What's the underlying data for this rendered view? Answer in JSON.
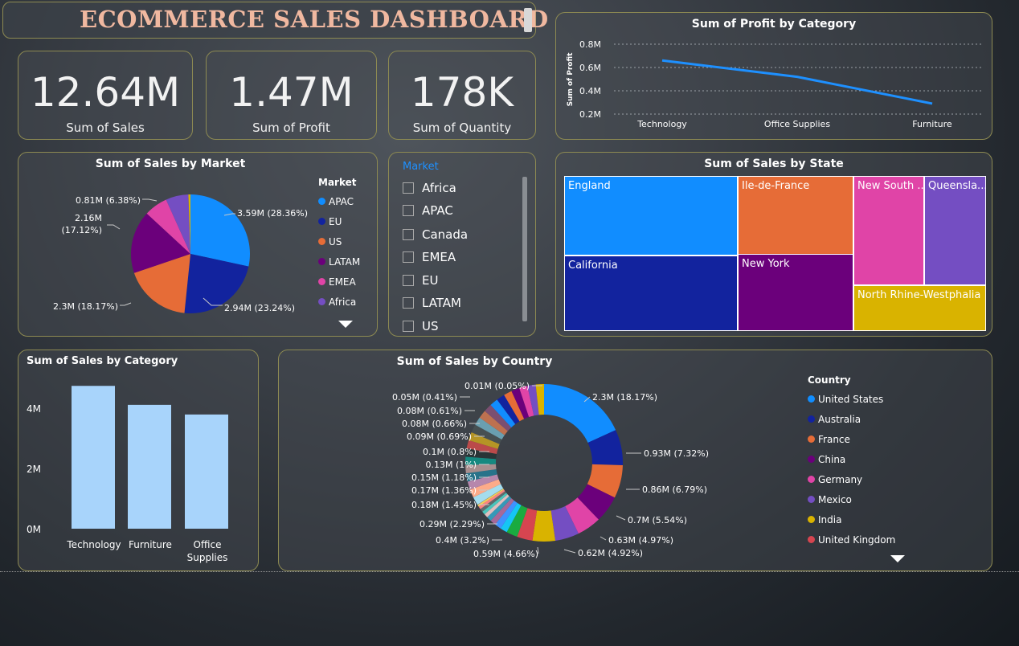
{
  "header": {
    "title": "ECOMMERCE SALES DASHBOARD"
  },
  "kpis": [
    {
      "value": "12.64M",
      "label": "Sum of Sales"
    },
    {
      "value": "1.47M",
      "label": "Sum of Profit"
    },
    {
      "value": "178K",
      "label": "Sum of Quantity"
    }
  ],
  "profit_chart": {
    "title": "Sum of Profit by Category",
    "ylabel": "Sum of Profit",
    "yticks": [
      "0.8M",
      "0.6M",
      "0.4M",
      "0.2M"
    ],
    "categories": [
      "Technology",
      "Office Supplies",
      "Furniture"
    ],
    "line_color": "#1e90ff"
  },
  "market_pie": {
    "title": "Sum of Sales by Market",
    "legend_title": "Market",
    "labels": [
      "3.59M (28.36%)",
      "2.94M (23.24%)",
      "2.3M (18.17%)",
      "2.16M",
      "(17.12%)",
      "0.81M (6.38%)"
    ]
  },
  "market_slicer": {
    "title": "Market",
    "items": [
      "Africa",
      "APAC",
      "Canada",
      "EMEA",
      "EU",
      "LATAM",
      "US"
    ]
  },
  "state_treemap": {
    "title": "Sum of Sales by State",
    "cells": [
      "England",
      "Ile-de-France",
      "New South ...",
      "Queensla...",
      "California",
      "New York",
      "North Rhine-Westphalia"
    ]
  },
  "category_bar": {
    "title": "Sum of Sales by Category",
    "yticks": [
      "4M",
      "2M",
      "0M"
    ],
    "categories": [
      "Technology",
      "Furniture",
      "Office",
      "Supplies"
    ],
    "bar_color": "#a8d4fb"
  },
  "country_donut": {
    "title": "Sum of Sales by Country",
    "legend_title": "Country",
    "right_labels": [
      "2.3M (18.17%)",
      "0.93M (7.32%)",
      "0.86M (6.79%)",
      "0.7M (5.54%)",
      "0.63M (4.97%)",
      "0.62M (4.92%)",
      "0.59M (4.66%)"
    ],
    "left_labels": [
      "0.01M (0.05%)",
      "0.05M (0.41%)",
      "0.08M (0.61%)",
      "0.08M (0.66%)",
      "0.09M (0.69%)",
      "0.1M (0.8%)",
      "0.13M (1%)",
      "0.15M (1.18%)",
      "0.17M (1.36%)",
      "0.18M (1.45%)",
      "0.29M (2.29%)",
      "0.4M (3.2%)"
    ]
  },
  "chart_data": [
    {
      "type": "line",
      "title": "Sum of Profit by Category",
      "categories": [
        "Technology",
        "Office Supplies",
        "Furniture"
      ],
      "values": [
        0.66,
        0.52,
        0.29
      ],
      "ylabel": "Sum of Profit",
      "unit": "M",
      "ylim": [
        0.2,
        0.8
      ],
      "grid": true
    },
    {
      "type": "pie",
      "title": "Sum of Sales by Market",
      "categories": [
        "APAC",
        "EU",
        "US",
        "LATAM",
        "EMEA",
        "Africa",
        "Canada"
      ],
      "values": [
        3.59,
        2.94,
        2.3,
        2.16,
        0.81,
        0.78,
        0.07
      ],
      "percentages": [
        28.36,
        23.24,
        18.17,
        17.12,
        6.38,
        6.16,
        0.57
      ],
      "colors": [
        "#118dff",
        "#12239e",
        "#e66c37",
        "#6b007b",
        "#e044a7",
        "#744ec2",
        "#d9b300"
      ],
      "legend": "right"
    },
    {
      "type": "treemap",
      "title": "Sum of Sales by State",
      "categories": [
        "England",
        "California",
        "Ile-de-France",
        "New York",
        "New South Wales",
        "North Rhine-Westphalia",
        "Queensland"
      ],
      "colors": [
        "#118dff",
        "#12239e",
        "#e66c37",
        "#6b007b",
        "#e044a7",
        "#d9b300",
        "#744ec2"
      ]
    },
    {
      "type": "bar",
      "title": "Sum of Sales by Category",
      "categories": [
        "Technology",
        "Furniture",
        "Office Supplies"
      ],
      "values": [
        4.74,
        4.11,
        3.79
      ],
      "ylim": [
        0,
        5
      ],
      "unit": "M"
    },
    {
      "type": "pie",
      "donut": true,
      "title": "Sum of Sales by Country",
      "categories": [
        "United States",
        "Australia",
        "France",
        "China",
        "Germany",
        "Mexico",
        "India",
        "United Kingdom"
      ],
      "values": [
        2.3,
        0.93,
        0.86,
        0.7,
        0.63,
        0.62,
        0.59,
        0.4,
        0.29,
        0.18,
        0.17,
        0.15,
        0.13,
        0.1,
        0.09,
        0.08,
        0.08,
        0.05,
        0.01
      ],
      "percentages": [
        18.17,
        7.32,
        6.79,
        5.54,
        4.97,
        4.92,
        4.66,
        3.2,
        2.29,
        1.45,
        1.36,
        1.18,
        1.0,
        0.8,
        0.69,
        0.66,
        0.61,
        0.41,
        0.05
      ],
      "colors": [
        "#118dff",
        "#12239e",
        "#e66c37",
        "#6b007b",
        "#e044a7",
        "#744ec2",
        "#d9b300",
        "#d64550"
      ],
      "legend": "right"
    }
  ]
}
